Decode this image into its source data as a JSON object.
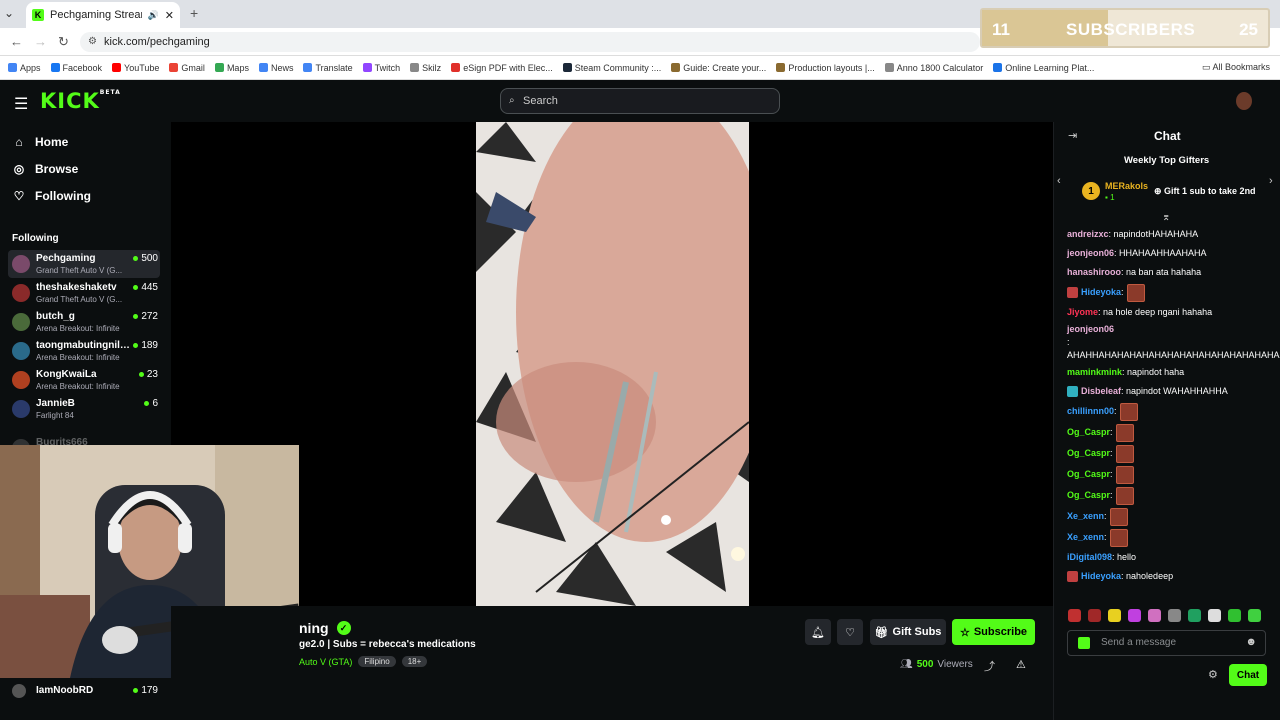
{
  "browser": {
    "tab_title": "Pechgaming Stream - Watc",
    "tab_favicon": "K",
    "url": "kick.com/pechgaming",
    "bookmarks": [
      "Apps",
      "Facebook",
      "YouTube",
      "Gmail",
      "Maps",
      "News",
      "Translate",
      "Twitch",
      "Skilz",
      "eSign PDF with Elec...",
      "Steam Community :...",
      "Guide: Create your...",
      "Production layouts |...",
      "Anno 1800 Calculator",
      "Online Learning Plat..."
    ],
    "all_bookmarks": "All Bookmarks"
  },
  "overlay": {
    "sub_current": "11",
    "sub_label": "SUBSCRIBERS",
    "sub_goal": "25",
    "progress_fraction": 0.44
  },
  "header": {
    "logo": "KICK",
    "logo_sup": "BETA",
    "search_placeholder": "Search"
  },
  "nav": {
    "home": "Home",
    "browse": "Browse",
    "following": "Following"
  },
  "following": {
    "heading": "Following",
    "items": [
      {
        "name": "Pechgaming",
        "game": "Grand Theft Auto V (G...",
        "viewers": "500",
        "color": "#7a4a6a"
      },
      {
        "name": "theshakeshaketv",
        "game": "Grand Theft Auto V (G...",
        "viewers": "445",
        "color": "#8a2a2a"
      },
      {
        "name": "butch_g",
        "game": "Arena Breakout: Infinite",
        "viewers": "272",
        "color": "#4a6a3a"
      },
      {
        "name": "taongmabutingnila...",
        "game": "Arena Breakout: Infinite",
        "viewers": "189",
        "color": "#2a6a8a"
      },
      {
        "name": "KongKwaiLa",
        "game": "Arena Breakout: Infinite",
        "viewers": "23",
        "color": "#b04020"
      },
      {
        "name": "JannieB",
        "game": "Farlight 84",
        "viewers": "6",
        "color": "#2a3a6a"
      }
    ],
    "faded_item": "Bugrits666",
    "last_item": {
      "name": "IamNoobRD",
      "viewers": "179"
    }
  },
  "stream": {
    "name_fragment": "ning",
    "title_fragment": "ge2.0 | Subs = rebecca's medications",
    "category_fragment": "Auto V (GTA)",
    "tags": [
      "Filipino",
      "18+"
    ],
    "gift_label": "Gift Subs",
    "subscribe_label": "Subscribe",
    "viewers": "500",
    "viewers_label": "Viewers"
  },
  "chat": {
    "title": "Chat",
    "weekly_title": "Weekly Top Gifters",
    "gifter": {
      "rank": "1",
      "name": "MERakols",
      "count": "1",
      "cta": "Gift 1 sub to take 2nd"
    },
    "messages": [
      {
        "user": "andreizxc",
        "color": "#e8b0d8",
        "text": ": napindotHAHAHAHA"
      },
      {
        "user": "jeonjeon06",
        "color": "#e8b0d8",
        "text": ": HHAHAAHHAAHAHA"
      },
      {
        "user": "hanashirooo",
        "color": "#e8b0d8",
        "text": ": na ban ata hahaha"
      },
      {
        "user": "Hideyoka",
        "color": "#3aa0ff",
        "text": ":",
        "emote": true,
        "badge": "#c04040"
      },
      {
        "user": "Jiyome",
        "color": "#ff3355",
        "text": ": na hole deep ngani hahaha"
      },
      {
        "user": "jeonjeon06",
        "color": "#e8b0d8",
        "text": ": AHAHHAHAHAHAHAHAHAHAHAHAHAHAHAHAHA"
      },
      {
        "user": "maminkmink",
        "color": "#53fc18",
        "text": ": napindot haha"
      },
      {
        "user": "Disbeleaf",
        "color": "#e8b0d8",
        "text": ": napindot WAHAHHAHHA",
        "badge": "#30b0c0"
      },
      {
        "user": "chillinnn00",
        "color": "#3aa0ff",
        "text": ":",
        "emote": true
      },
      {
        "user": "Og_Caspr",
        "color": "#53fc18",
        "text": ":",
        "emote": true
      },
      {
        "user": "Og_Caspr",
        "color": "#53fc18",
        "text": ":",
        "emote": true
      },
      {
        "user": "Og_Caspr",
        "color": "#53fc18",
        "text": ":",
        "emote": true
      },
      {
        "user": "Og_Caspr",
        "color": "#53fc18",
        "text": ":",
        "emote": true
      },
      {
        "user": "Xe_xenn",
        "color": "#3aa0ff",
        "text": ":",
        "emote": true
      },
      {
        "user": "Xe_xenn",
        "color": "#3aa0ff",
        "text": ":",
        "emote": true
      },
      {
        "user": "iDigital098",
        "color": "#3aa0ff",
        "text": ": hello"
      },
      {
        "user": "Hideyoka",
        "color": "#3aa0ff",
        "text": ": naholedeep",
        "badge": "#c04040"
      }
    ],
    "send_placeholder": "Send a message",
    "chat_button": "Chat"
  },
  "colors": {
    "brand": "#53fc18",
    "bg": "#0b0e0f",
    "gold": "#e9b320"
  }
}
